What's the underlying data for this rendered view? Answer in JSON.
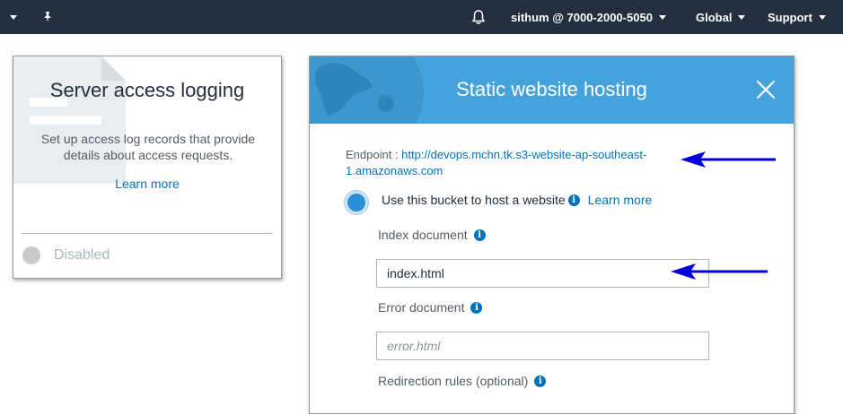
{
  "topbar": {
    "account": "sithum @ 7000-2000-5050",
    "region": "Global",
    "support": "Support"
  },
  "logging_card": {
    "title": "Server access logging",
    "description": "Set up access log records that provide details about access requests.",
    "learn_more": "Learn more",
    "status": "Disabled"
  },
  "hosting_card": {
    "title": "Static website hosting",
    "endpoint_label": "Endpoint : ",
    "endpoint_url": "http://devops.mchn.tk.s3-website-ap-southeast-1.amazonaws.com",
    "use_bucket_label": "Use this bucket to host a website",
    "learn_more": "Learn more",
    "info_glyph": "i",
    "index_label": "Index document",
    "index_value": "index.html",
    "error_label": "Error document",
    "error_placeholder": "error.html",
    "redirect_label": "Redirection rules (optional)"
  },
  "colors": {
    "nav_bg": "#232f3e",
    "header_blue": "#44a3dc",
    "link": "#0073bb",
    "annotation_arrow": "#0000dd"
  }
}
